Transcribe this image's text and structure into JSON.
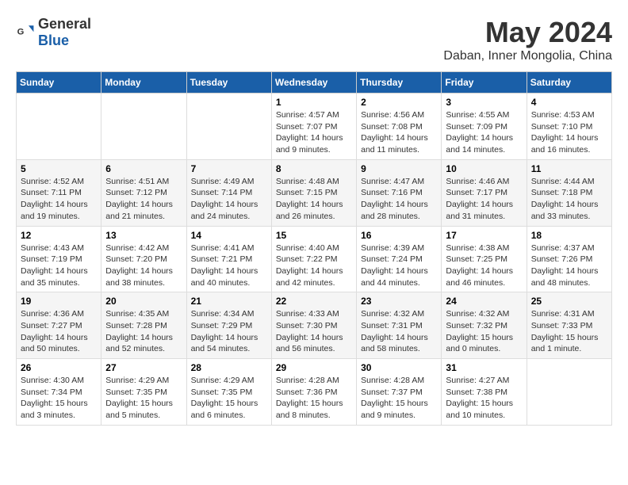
{
  "logo": {
    "general": "General",
    "blue": "Blue"
  },
  "header": {
    "month": "May 2024",
    "location": "Daban, Inner Mongolia, China"
  },
  "weekdays": [
    "Sunday",
    "Monday",
    "Tuesday",
    "Wednesday",
    "Thursday",
    "Friday",
    "Saturday"
  ],
  "weeks": [
    [
      {
        "day": "",
        "info": ""
      },
      {
        "day": "",
        "info": ""
      },
      {
        "day": "",
        "info": ""
      },
      {
        "day": "1",
        "info": "Sunrise: 4:57 AM\nSunset: 7:07 PM\nDaylight: 14 hours\nand 9 minutes."
      },
      {
        "day": "2",
        "info": "Sunrise: 4:56 AM\nSunset: 7:08 PM\nDaylight: 14 hours\nand 11 minutes."
      },
      {
        "day": "3",
        "info": "Sunrise: 4:55 AM\nSunset: 7:09 PM\nDaylight: 14 hours\nand 14 minutes."
      },
      {
        "day": "4",
        "info": "Sunrise: 4:53 AM\nSunset: 7:10 PM\nDaylight: 14 hours\nand 16 minutes."
      }
    ],
    [
      {
        "day": "5",
        "info": "Sunrise: 4:52 AM\nSunset: 7:11 PM\nDaylight: 14 hours\nand 19 minutes."
      },
      {
        "day": "6",
        "info": "Sunrise: 4:51 AM\nSunset: 7:12 PM\nDaylight: 14 hours\nand 21 minutes."
      },
      {
        "day": "7",
        "info": "Sunrise: 4:49 AM\nSunset: 7:14 PM\nDaylight: 14 hours\nand 24 minutes."
      },
      {
        "day": "8",
        "info": "Sunrise: 4:48 AM\nSunset: 7:15 PM\nDaylight: 14 hours\nand 26 minutes."
      },
      {
        "day": "9",
        "info": "Sunrise: 4:47 AM\nSunset: 7:16 PM\nDaylight: 14 hours\nand 28 minutes."
      },
      {
        "day": "10",
        "info": "Sunrise: 4:46 AM\nSunset: 7:17 PM\nDaylight: 14 hours\nand 31 minutes."
      },
      {
        "day": "11",
        "info": "Sunrise: 4:44 AM\nSunset: 7:18 PM\nDaylight: 14 hours\nand 33 minutes."
      }
    ],
    [
      {
        "day": "12",
        "info": "Sunrise: 4:43 AM\nSunset: 7:19 PM\nDaylight: 14 hours\nand 35 minutes."
      },
      {
        "day": "13",
        "info": "Sunrise: 4:42 AM\nSunset: 7:20 PM\nDaylight: 14 hours\nand 38 minutes."
      },
      {
        "day": "14",
        "info": "Sunrise: 4:41 AM\nSunset: 7:21 PM\nDaylight: 14 hours\nand 40 minutes."
      },
      {
        "day": "15",
        "info": "Sunrise: 4:40 AM\nSunset: 7:22 PM\nDaylight: 14 hours\nand 42 minutes."
      },
      {
        "day": "16",
        "info": "Sunrise: 4:39 AM\nSunset: 7:24 PM\nDaylight: 14 hours\nand 44 minutes."
      },
      {
        "day": "17",
        "info": "Sunrise: 4:38 AM\nSunset: 7:25 PM\nDaylight: 14 hours\nand 46 minutes."
      },
      {
        "day": "18",
        "info": "Sunrise: 4:37 AM\nSunset: 7:26 PM\nDaylight: 14 hours\nand 48 minutes."
      }
    ],
    [
      {
        "day": "19",
        "info": "Sunrise: 4:36 AM\nSunset: 7:27 PM\nDaylight: 14 hours\nand 50 minutes."
      },
      {
        "day": "20",
        "info": "Sunrise: 4:35 AM\nSunset: 7:28 PM\nDaylight: 14 hours\nand 52 minutes."
      },
      {
        "day": "21",
        "info": "Sunrise: 4:34 AM\nSunset: 7:29 PM\nDaylight: 14 hours\nand 54 minutes."
      },
      {
        "day": "22",
        "info": "Sunrise: 4:33 AM\nSunset: 7:30 PM\nDaylight: 14 hours\nand 56 minutes."
      },
      {
        "day": "23",
        "info": "Sunrise: 4:32 AM\nSunset: 7:31 PM\nDaylight: 14 hours\nand 58 minutes."
      },
      {
        "day": "24",
        "info": "Sunrise: 4:32 AM\nSunset: 7:32 PM\nDaylight: 15 hours\nand 0 minutes."
      },
      {
        "day": "25",
        "info": "Sunrise: 4:31 AM\nSunset: 7:33 PM\nDaylight: 15 hours\nand 1 minute."
      }
    ],
    [
      {
        "day": "26",
        "info": "Sunrise: 4:30 AM\nSunset: 7:34 PM\nDaylight: 15 hours\nand 3 minutes."
      },
      {
        "day": "27",
        "info": "Sunrise: 4:29 AM\nSunset: 7:35 PM\nDaylight: 15 hours\nand 5 minutes."
      },
      {
        "day": "28",
        "info": "Sunrise: 4:29 AM\nSunset: 7:35 PM\nDaylight: 15 hours\nand 6 minutes."
      },
      {
        "day": "29",
        "info": "Sunrise: 4:28 AM\nSunset: 7:36 PM\nDaylight: 15 hours\nand 8 minutes."
      },
      {
        "day": "30",
        "info": "Sunrise: 4:28 AM\nSunset: 7:37 PM\nDaylight: 15 hours\nand 9 minutes."
      },
      {
        "day": "31",
        "info": "Sunrise: 4:27 AM\nSunset: 7:38 PM\nDaylight: 15 hours\nand 10 minutes."
      },
      {
        "day": "",
        "info": ""
      }
    ]
  ]
}
